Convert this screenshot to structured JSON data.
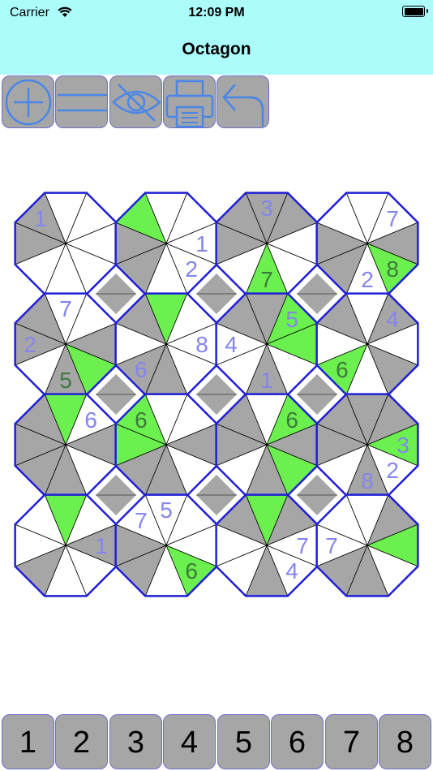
{
  "status": {
    "carrier": "Carrier",
    "time": "12:09 PM"
  },
  "title": "Octagon",
  "toolbar": [
    {
      "name": "add-button",
      "icon": "plus-circle-icon"
    },
    {
      "name": "equals-button",
      "icon": "equals-icon"
    },
    {
      "name": "hide-button",
      "icon": "eye-slash-icon"
    },
    {
      "name": "print-button",
      "icon": "printer-icon"
    },
    {
      "name": "undo-button",
      "icon": "undo-arrow-icon"
    }
  ],
  "colors": {
    "header": "#abfcfb",
    "button": "#a6a6a6",
    "icon": "#4a86e8",
    "board_border": "#1f1fd6",
    "gray": "#a6a6a6",
    "green": "#6cf04f",
    "given": "#3d7a3d",
    "entered": "#8585ee"
  },
  "numpad": [
    "1",
    "2",
    "3",
    "4",
    "5",
    "6",
    "7",
    "8"
  ],
  "board": {
    "octagons": [
      {
        "gray": [
          6,
          7
        ],
        "green": [],
        "labels": [
          {
            "w": 7,
            "v": "1",
            "t": "entered"
          }
        ]
      },
      {
        "gray": [
          5,
          6
        ],
        "green": [
          7
        ],
        "labels": [
          {
            "w": 2,
            "v": "1",
            "t": "entered"
          },
          {
            "w": 3,
            "v": "2",
            "t": "entered"
          }
        ]
      },
      {
        "gray": [
          0,
          1,
          6,
          7
        ],
        "green": [
          4
        ],
        "labels": [
          {
            "w": 0,
            "v": "3",
            "t": "entered"
          },
          {
            "w": 4,
            "v": "7",
            "t": "given"
          }
        ]
      },
      {
        "gray": [
          2,
          5,
          6
        ],
        "green": [
          3
        ],
        "labels": [
          {
            "w": 1,
            "v": "7",
            "t": "entered"
          },
          {
            "w": 3,
            "v": "8",
            "t": "given"
          },
          {
            "w": 4,
            "v": "2",
            "t": "entered"
          }
        ]
      },
      {
        "gray": [
          2,
          4,
          6,
          7
        ],
        "green": [
          3
        ],
        "labels": [
          {
            "w": 0,
            "v": "7",
            "t": "entered"
          },
          {
            "w": 4,
            "v": "5",
            "t": "given"
          },
          {
            "w": 6,
            "v": "2",
            "t": "entered"
          }
        ]
      },
      {
        "gray": [
          4,
          5,
          7
        ],
        "green": [
          0
        ],
        "labels": [
          {
            "w": 2,
            "v": "8",
            "t": "entered"
          },
          {
            "w": 5,
            "v": "6",
            "t": "entered"
          }
        ]
      },
      {
        "gray": [
          0,
          4,
          7
        ],
        "green": [
          1,
          2
        ],
        "labels": [
          {
            "w": 1,
            "v": "5",
            "t": "entered"
          },
          {
            "w": 4,
            "v": "1",
            "t": "entered"
          },
          {
            "w": 6,
            "v": "4",
            "t": "entered"
          }
        ]
      },
      {
        "gray": [
          1,
          3,
          7
        ],
        "green": [
          5
        ],
        "labels": [
          {
            "w": 1,
            "v": "4",
            "t": "entered"
          },
          {
            "w": 5,
            "v": "6",
            "t": "given"
          }
        ]
      },
      {
        "gray": [
          2,
          4,
          5,
          6,
          7
        ],
        "green": [
          0
        ],
        "labels": [
          {
            "w": 1,
            "v": "6",
            "t": "entered"
          }
        ]
      },
      {
        "gray": [
          2,
          4,
          5
        ],
        "green": [
          6,
          7
        ],
        "labels": [
          {
            "w": 7,
            "v": "6",
            "t": "given"
          }
        ]
      },
      {
        "gray": [
          2,
          4,
          6,
          7
        ],
        "green": [
          1,
          3
        ],
        "labels": [
          {
            "w": 1,
            "v": "6",
            "t": "given"
          }
        ]
      },
      {
        "gray": [
          0,
          1,
          4,
          6,
          7
        ],
        "green": [
          2
        ],
        "labels": [
          {
            "w": 2,
            "v": "3",
            "t": "entered"
          },
          {
            "w": 3,
            "v": "2",
            "t": "entered"
          },
          {
            "w": 4,
            "v": "8",
            "t": "entered"
          }
        ]
      },
      {
        "gray": [
          2,
          5
        ],
        "green": [
          0
        ],
        "labels": [
          {
            "w": 2,
            "v": "1",
            "t": "entered"
          }
        ]
      },
      {
        "gray": [
          5,
          6
        ],
        "green": [
          3
        ],
        "labels": [
          {
            "w": 0,
            "v": "5",
            "t": "entered"
          },
          {
            "w": 7,
            "v": "7",
            "t": "entered"
          },
          {
            "w": 3,
            "v": "6",
            "t": "given"
          }
        ]
      },
      {
        "gray": [
          1,
          4,
          7
        ],
        "green": [
          0
        ],
        "labels": [
          {
            "w": 2,
            "v": "7",
            "t": "entered"
          },
          {
            "w": 3,
            "v": "4",
            "t": "entered"
          }
        ]
      },
      {
        "gray": [
          1,
          4,
          5
        ],
        "green": [
          2
        ],
        "labels": [
          {
            "w": 6,
            "v": "7",
            "t": "entered"
          }
        ]
      }
    ]
  }
}
